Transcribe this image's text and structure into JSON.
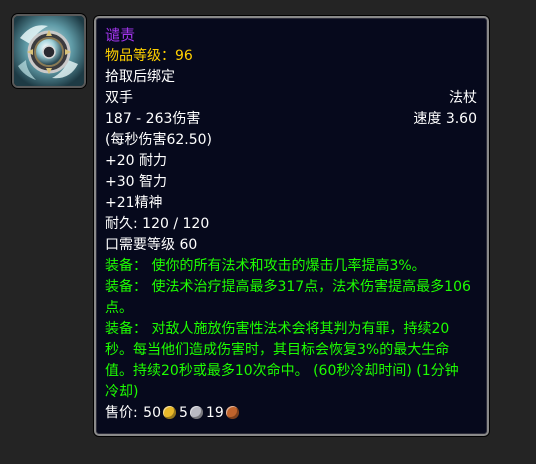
{
  "item": {
    "name": "谴责",
    "item_level_label": "物品等级：",
    "item_level": "96",
    "binding": "拾取后绑定",
    "slot": "双手",
    "weapon_type": "法杖",
    "damage": "187 - 263伤害",
    "speed": "速度 3.60",
    "dps": "(每秒伤害62.50)",
    "stats": [
      "+20 耐力",
      "+30 智力",
      "+21精神"
    ],
    "durability": "耐久: 120 / 120",
    "required_level": "口需要等级 60",
    "equip_effects": [
      "装备：  使你的所有法术和攻击的爆击几率提高3%。",
      "装备：  使法术治疗提高最多317点，法术伤害提高最多106点。",
      "装备：  对敌人施放伤害性法术会将其判为有罪，持续20秒。每当他们造成伤害时，其目标会恢复3%的最大生命值。持续20秒或最多10次命中。 (60秒冷却时间)  (1分钟 冷却)"
    ],
    "sell_price": {
      "label": "售价: ",
      "gold": "50",
      "silver": "5",
      "copper": "19"
    }
  },
  "icon": "staff-orb-icon",
  "colors": {
    "epic": "#a335ee",
    "item_level": "#ffd100",
    "equip": "#1eff00",
    "background": "#06091c",
    "border": "#8a8a8a"
  }
}
